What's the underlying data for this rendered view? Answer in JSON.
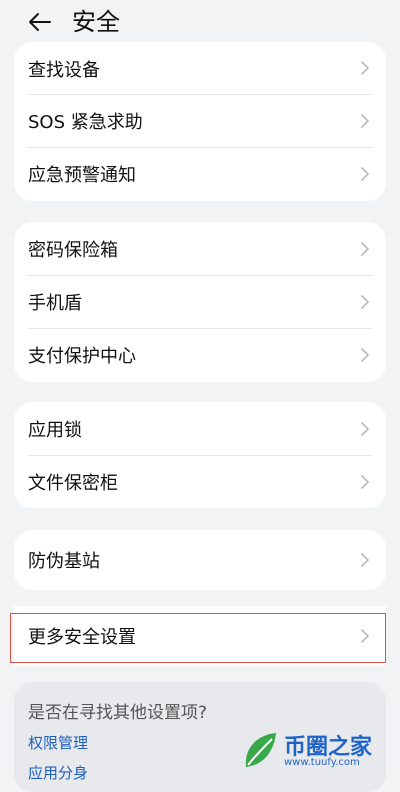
{
  "header": {
    "title": "安全"
  },
  "groups": [
    {
      "items": [
        "查找设备",
        "SOS 紧急求助",
        "应急预警通知"
      ]
    },
    {
      "items": [
        "密码保险箱",
        "手机盾",
        "支付保护中心"
      ]
    },
    {
      "items": [
        "应用锁",
        "文件保密柜"
      ]
    },
    {
      "items": [
        "防伪基站"
      ]
    },
    {
      "items": [
        "更多安全设置"
      ]
    }
  ],
  "suggestions": {
    "prompt": "是否在寻找其他设置项?",
    "links": [
      "权限管理",
      "应用分身"
    ]
  },
  "watermark": {
    "brand": "币圈之家",
    "url": "www.tuufy.com"
  },
  "colors": {
    "link": "#1f5fbf",
    "highlight_border": "#d9534f",
    "watermark": "#1e63c8"
  }
}
